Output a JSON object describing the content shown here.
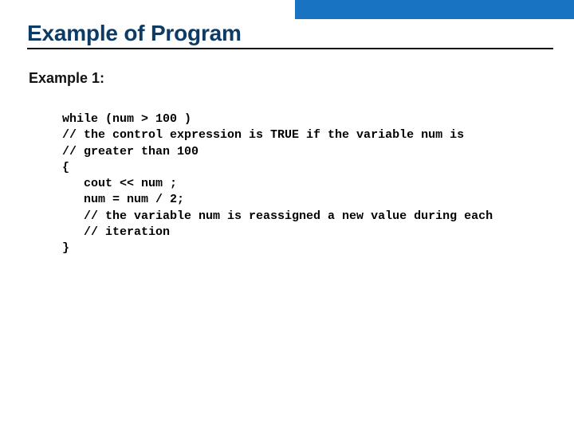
{
  "title": "Example of Program",
  "subtitle": "Example 1:",
  "code": "while (num > 100 )\n// the control expression is TRUE if the variable num is\n// greater than 100\n{\n   cout << num ;\n   num = num / 2;\n   // the variable num is reassigned a new value during each\n   // iteration\n}"
}
